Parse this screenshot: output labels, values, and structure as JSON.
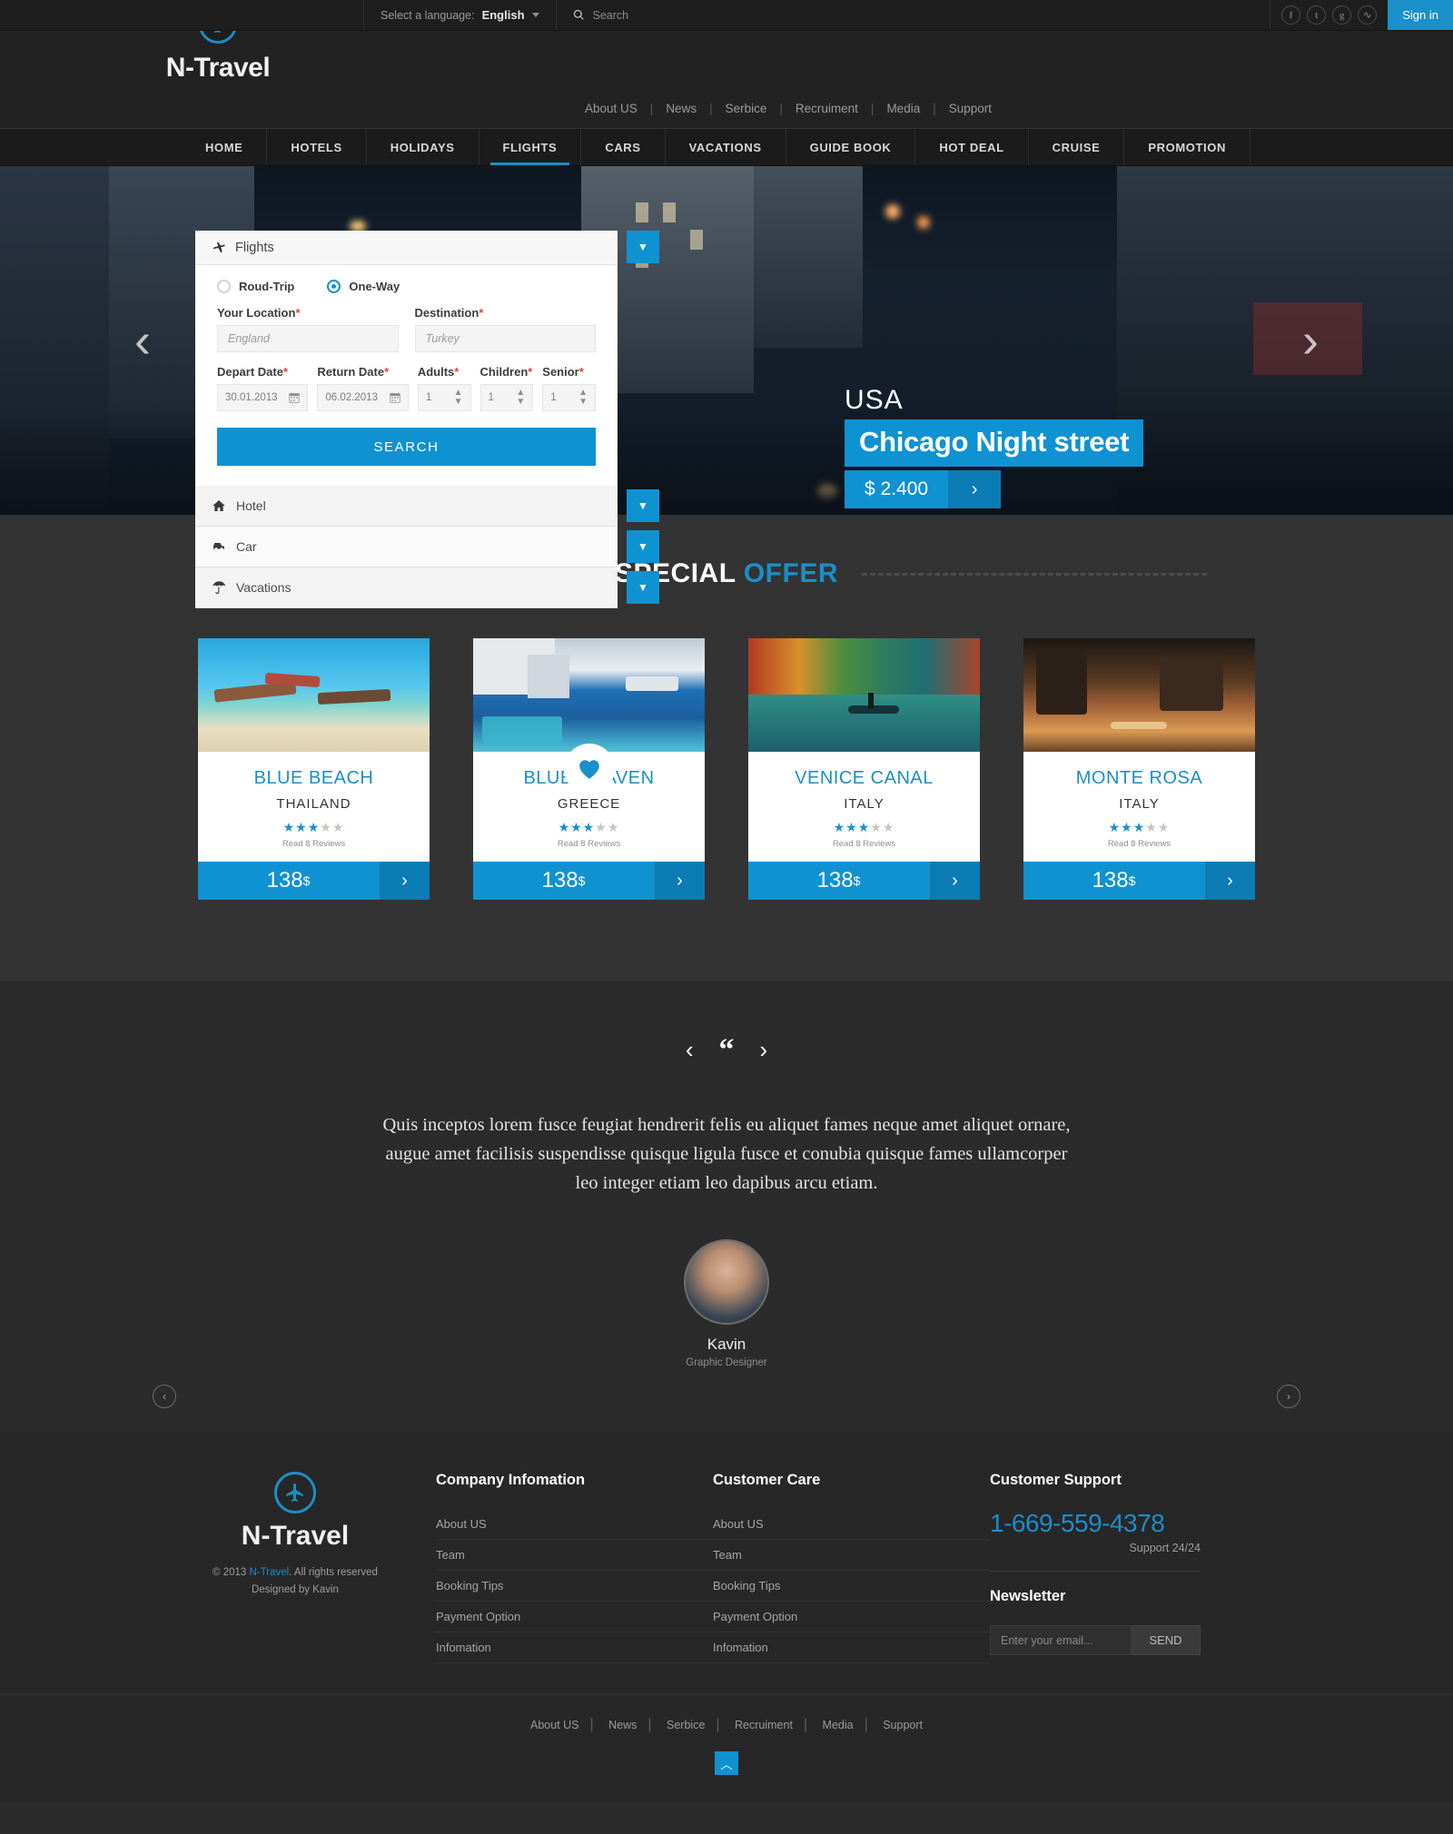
{
  "topbar": {
    "language_label": "Select a language:",
    "language_value": "English",
    "search_placeholder": "Search",
    "social": [
      "facebook-icon",
      "twitter-icon",
      "google-plus-icon",
      "rss-icon"
    ],
    "signin_label": "Sign in"
  },
  "header": {
    "logo_text": "N-Travel",
    "nav": [
      "About US",
      "News",
      "Serbice",
      "Recruiment",
      "Media",
      "Support"
    ]
  },
  "mainnav": {
    "items": [
      "HOME",
      "HOTELS",
      "HOLIDAYS",
      "FLIGHTS",
      "CARS",
      "VACATIONS",
      "GUIDE BOOK",
      "HOT DEAL",
      "CRUISE",
      "PROMOTION"
    ],
    "active": "FLIGHTS"
  },
  "booker": {
    "title": "Flights",
    "trip_roundtrip": "Roud-Trip",
    "trip_oneway": "One-Way",
    "selected_trip": "One-Way",
    "location_label": "Your Location",
    "location_placeholder": "England",
    "destination_label": "Destination",
    "destination_placeholder": "Turkey",
    "depart_label": "Depart Date",
    "depart_value": "30.01.2013",
    "return_label": "Return Date",
    "return_value": "06.02.2013",
    "adults_label": "Adults",
    "adults_value": "1",
    "children_label": "Children",
    "children_value": "1",
    "senior_label": "Senior",
    "senior_value": "1",
    "search_label": "SEARCH",
    "tabs": [
      {
        "label": "Hotel",
        "icon": "home-icon"
      },
      {
        "label": "Car",
        "icon": "car-icon"
      },
      {
        "label": "Vacations",
        "icon": "umbrella-icon"
      }
    ]
  },
  "hero": {
    "country": "USA",
    "title": "Chicago Night street",
    "price": "$ 2.400",
    "prev_icon": "chevron-left-icon",
    "next_icon": "chevron-right-icon"
  },
  "offers": {
    "title_white": "SPECIAL",
    "title_blue": "OFFER",
    "cards": [
      {
        "name": "BLUE BEACH",
        "country": "THAILAND",
        "stars": 3,
        "reviews": "Read 8 Reviews",
        "price": "138",
        "currency": "$",
        "featured": false
      },
      {
        "name": "BLUE HEAVEN",
        "country": "GREECE",
        "stars": 3,
        "reviews": "Read 8 Reviews",
        "price": "138",
        "currency": "$",
        "featured": true
      },
      {
        "name": "VENICE CANAL",
        "country": "ITALY",
        "stars": 3,
        "reviews": "Read 8 Reviews",
        "price": "138",
        "currency": "$",
        "featured": false
      },
      {
        "name": "MONTE ROSA",
        "country": "ITALY",
        "stars": 3,
        "reviews": "Read 8 Reviews",
        "price": "138",
        "currency": "$",
        "featured": false
      }
    ]
  },
  "testimonial": {
    "quote": "Quis inceptos lorem fusce feugiat hendrerit felis eu aliquet fames neque amet aliquet ornare, augue amet facilisis suspendisse quisque ligula fusce et conubia quisque fames ullamcorper leo integer etiam leo dapibus arcu etiam.",
    "name": "Kavin",
    "role": "Graphic Designer"
  },
  "footer": {
    "logo_text": "N-Travel",
    "copyright_pre": "© 2013 ",
    "copyright_link": "N-Travel",
    "copyright_post": ". All rights reserved",
    "designed_by": "Designed by Kavin",
    "company_heading": "Company Infomation",
    "company_links": [
      "About US",
      "Team",
      "Booking Tips",
      "Payment Option",
      "Infomation"
    ],
    "care_heading": "Customer Care",
    "care_links": [
      "About US",
      "Team",
      "Booking Tips",
      "Payment Option",
      "Infomation"
    ],
    "support_heading": "Customer Support",
    "phone": "1-669-559-4378",
    "support_hours": "Support 24/24",
    "newsletter_heading": "Newsletter",
    "newsletter_placeholder": "Enter your email...",
    "newsletter_button": "SEND",
    "bottom_links": [
      "About US",
      "News",
      "Serbice",
      "Recruiment",
      "Media",
      "Support"
    ],
    "totop_icon": "chevron-up-icon"
  },
  "colors": {
    "accent": "#1a8fc9",
    "accent_dark": "#0b7cb4",
    "bg_dark": "#2b2b2b",
    "bg_offers": "#333333"
  }
}
